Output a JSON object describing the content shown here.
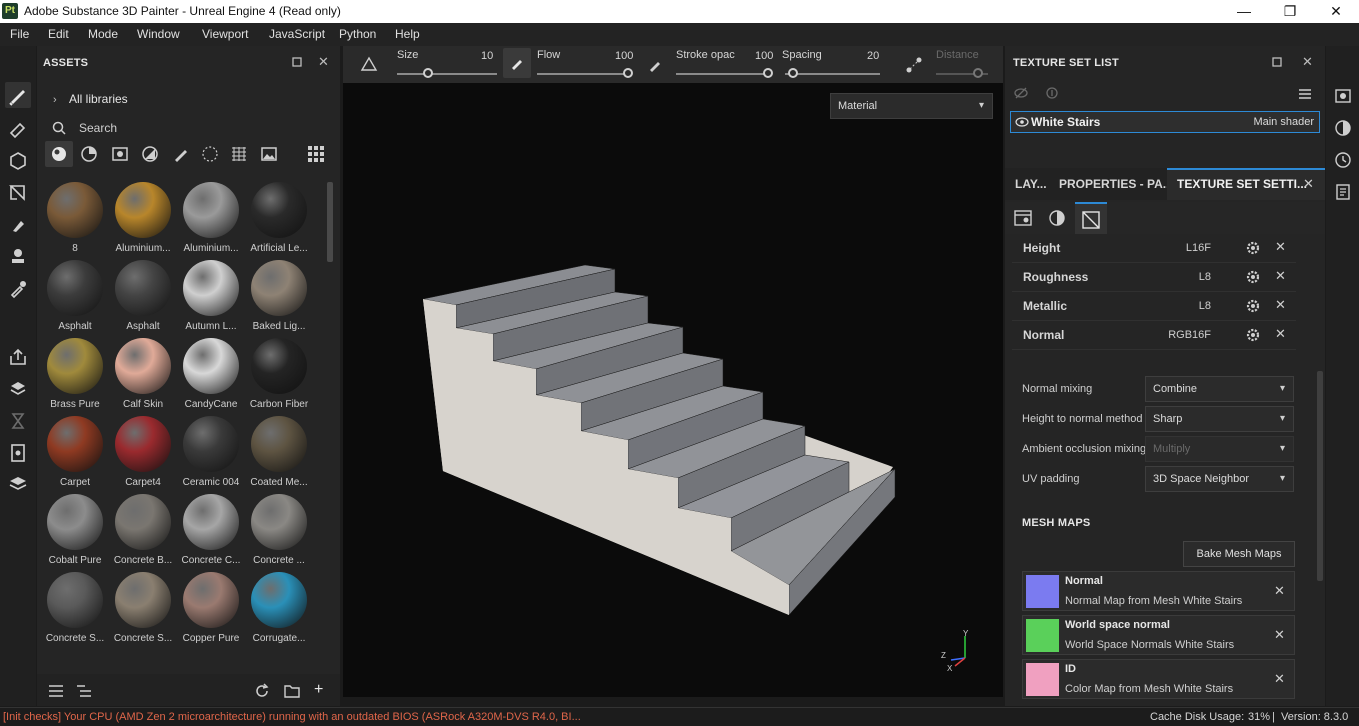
{
  "window": {
    "title": "Adobe Substance 3D Painter - Unreal Engine 4 (Read only)",
    "app_icon": "Pt",
    "minimize": "—",
    "maximize": "❐",
    "close": "✕"
  },
  "menu": [
    "File",
    "Edit",
    "Mode",
    "Window",
    "Viewport",
    "JavaScript",
    "Python",
    "Help"
  ],
  "assets": {
    "title": "ASSETS",
    "library": "All libraries",
    "search_placeholder": "Search",
    "items": [
      {
        "label": "8",
        "color": "#7a5a38"
      },
      {
        "label": "Aluminium...",
        "color": "#b8862b"
      },
      {
        "label": "Aluminium...",
        "color": "#9a9a9a"
      },
      {
        "label": "Artificial Le...",
        "color": "#2a2a2a"
      },
      {
        "label": "Asphalt",
        "color": "#3c3c3c"
      },
      {
        "label": "Asphalt",
        "color": "#444444"
      },
      {
        "label": "Autumn L...",
        "color": "#cfcfcf"
      },
      {
        "label": "Baked Lig...",
        "color": "#8e8274"
      },
      {
        "label": "Brass Pure",
        "color": "#a08a3c"
      },
      {
        "label": "Calf Skin",
        "color": "#e0aa98"
      },
      {
        "label": "CandyCane",
        "color": "#d8d8d8"
      },
      {
        "label": "Carbon Fiber",
        "color": "#242424"
      },
      {
        "label": "Carpet",
        "color": "#8f3a22"
      },
      {
        "label": "Carpet4",
        "color": "#9a2a2e"
      },
      {
        "label": "Ceramic 004",
        "color": "#3a3a3a"
      },
      {
        "label": "Coated Me...",
        "color": "#5e5442"
      },
      {
        "label": "Cobalt Pure",
        "color": "#8c8c8c"
      },
      {
        "label": "Concrete B...",
        "color": "#7a7670"
      },
      {
        "label": "Concrete C...",
        "color": "#a6a6a6"
      },
      {
        "label": "Concrete ...",
        "color": "#8a8884"
      },
      {
        "label": "Concrete S...",
        "color": "#5a5a5a"
      },
      {
        "label": "Concrete S...",
        "color": "#8a7f70"
      },
      {
        "label": "Copper Pure",
        "color": "#9a7a70"
      },
      {
        "label": "Corrugate...",
        "color": "#2a90b8"
      }
    ]
  },
  "toolbar": {
    "size_label": "Size",
    "size_value": "10",
    "flow_label": "Flow",
    "flow_value": "100",
    "stroke_label": "Stroke opac",
    "stroke_value": "100",
    "spacing_label": "Spacing",
    "spacing_value": "20",
    "distance_label": "Distance"
  },
  "viewport": {
    "mode": "Material",
    "axes": {
      "y": "Y",
      "z": "Z",
      "x": "X"
    }
  },
  "texture_set_list": {
    "title": "TEXTURE SET LIST",
    "item_name": "White Stairs",
    "item_shader": "Main shader"
  },
  "tabs": [
    "LAY...",
    "PROPERTIES - PA...",
    "TEXTURE SET SETTI..."
  ],
  "channels": [
    {
      "name": "Height",
      "format": "L16F"
    },
    {
      "name": "Roughness",
      "format": "L8"
    },
    {
      "name": "Metallic",
      "format": "L8"
    },
    {
      "name": "Normal",
      "format": "RGB16F"
    }
  ],
  "settings": [
    {
      "label": "Normal mixing",
      "value": "Combine",
      "disabled": false
    },
    {
      "label": "Height to normal method",
      "value": "Sharp",
      "disabled": false
    },
    {
      "label": "Ambient occlusion mixing",
      "value": "Multiply",
      "disabled": true
    },
    {
      "label": "UV padding",
      "value": "3D Space Neighbor",
      "disabled": false
    }
  ],
  "mesh_maps": {
    "title": "MESH MAPS",
    "bake_button": "Bake Mesh Maps",
    "items": [
      {
        "name": "Normal",
        "desc": "Normal Map from Mesh White Stairs",
        "thumb": "#7b7bf0"
      },
      {
        "name": "World space normal",
        "desc": "World Space Normals White Stairs",
        "thumb": "#5ad05a"
      },
      {
        "name": "ID",
        "desc": "Color Map from Mesh White Stairs",
        "thumb": "#f0a0c0"
      }
    ]
  },
  "status": {
    "message": "[Init checks] Your CPU (AMD Zen 2 microarchitecture) running with an outdated BIOS (ASRock A320M-DVS R4.0, BI...",
    "cache": "Cache Disk Usage:",
    "cache_value": "31%",
    "version": "Version: 8.3.0"
  },
  "colors": {
    "accent": "#2d8ad6",
    "status_error": "#e0664a"
  }
}
